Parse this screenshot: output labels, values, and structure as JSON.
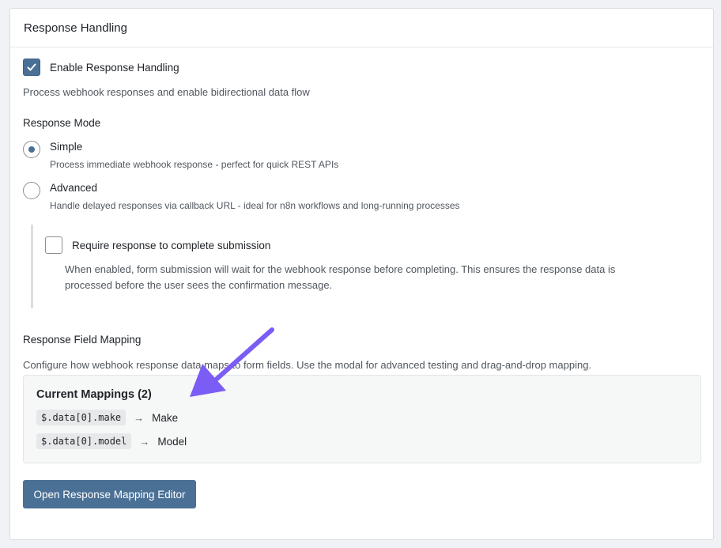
{
  "panel": {
    "title": "Response Handling"
  },
  "enable": {
    "label": "Enable Response Handling",
    "checked": true,
    "description": "Process webhook responses and enable bidirectional data flow"
  },
  "mode": {
    "title": "Response Mode",
    "selected": "simple",
    "options": [
      {
        "label": "Simple",
        "description": "Process immediate webhook response - perfect for quick REST APIs"
      },
      {
        "label": "Advanced",
        "description": "Handle delayed responses via callback URL - ideal for n8n workflows and long-running processes"
      }
    ]
  },
  "require": {
    "label": "Require response to complete submission",
    "checked": false,
    "description_line1": "When enabled, form submission will wait for the webhook response before completing. This ensures the response data is",
    "description_line2": "processed before the user sees the confirmation message."
  },
  "mapping": {
    "title": "Response Field Mapping",
    "description": "Configure how webhook response data maps to form fields. Use the modal for advanced testing and drag-and-drop mapping.",
    "current_title": "Current Mappings (2)",
    "arrow": "→",
    "rows": [
      {
        "path": "$.data[0].make",
        "field": "Make"
      },
      {
        "path": "$.data[0].model",
        "field": "Model"
      }
    ]
  },
  "editor_button": {
    "label": "Open Response Mapping Editor"
  },
  "colors": {
    "accent": "#4a7096",
    "annotation": "#7b5cf5"
  },
  "icons": {
    "check": "check-icon",
    "annotation_arrow": "annotation-arrow-icon"
  }
}
